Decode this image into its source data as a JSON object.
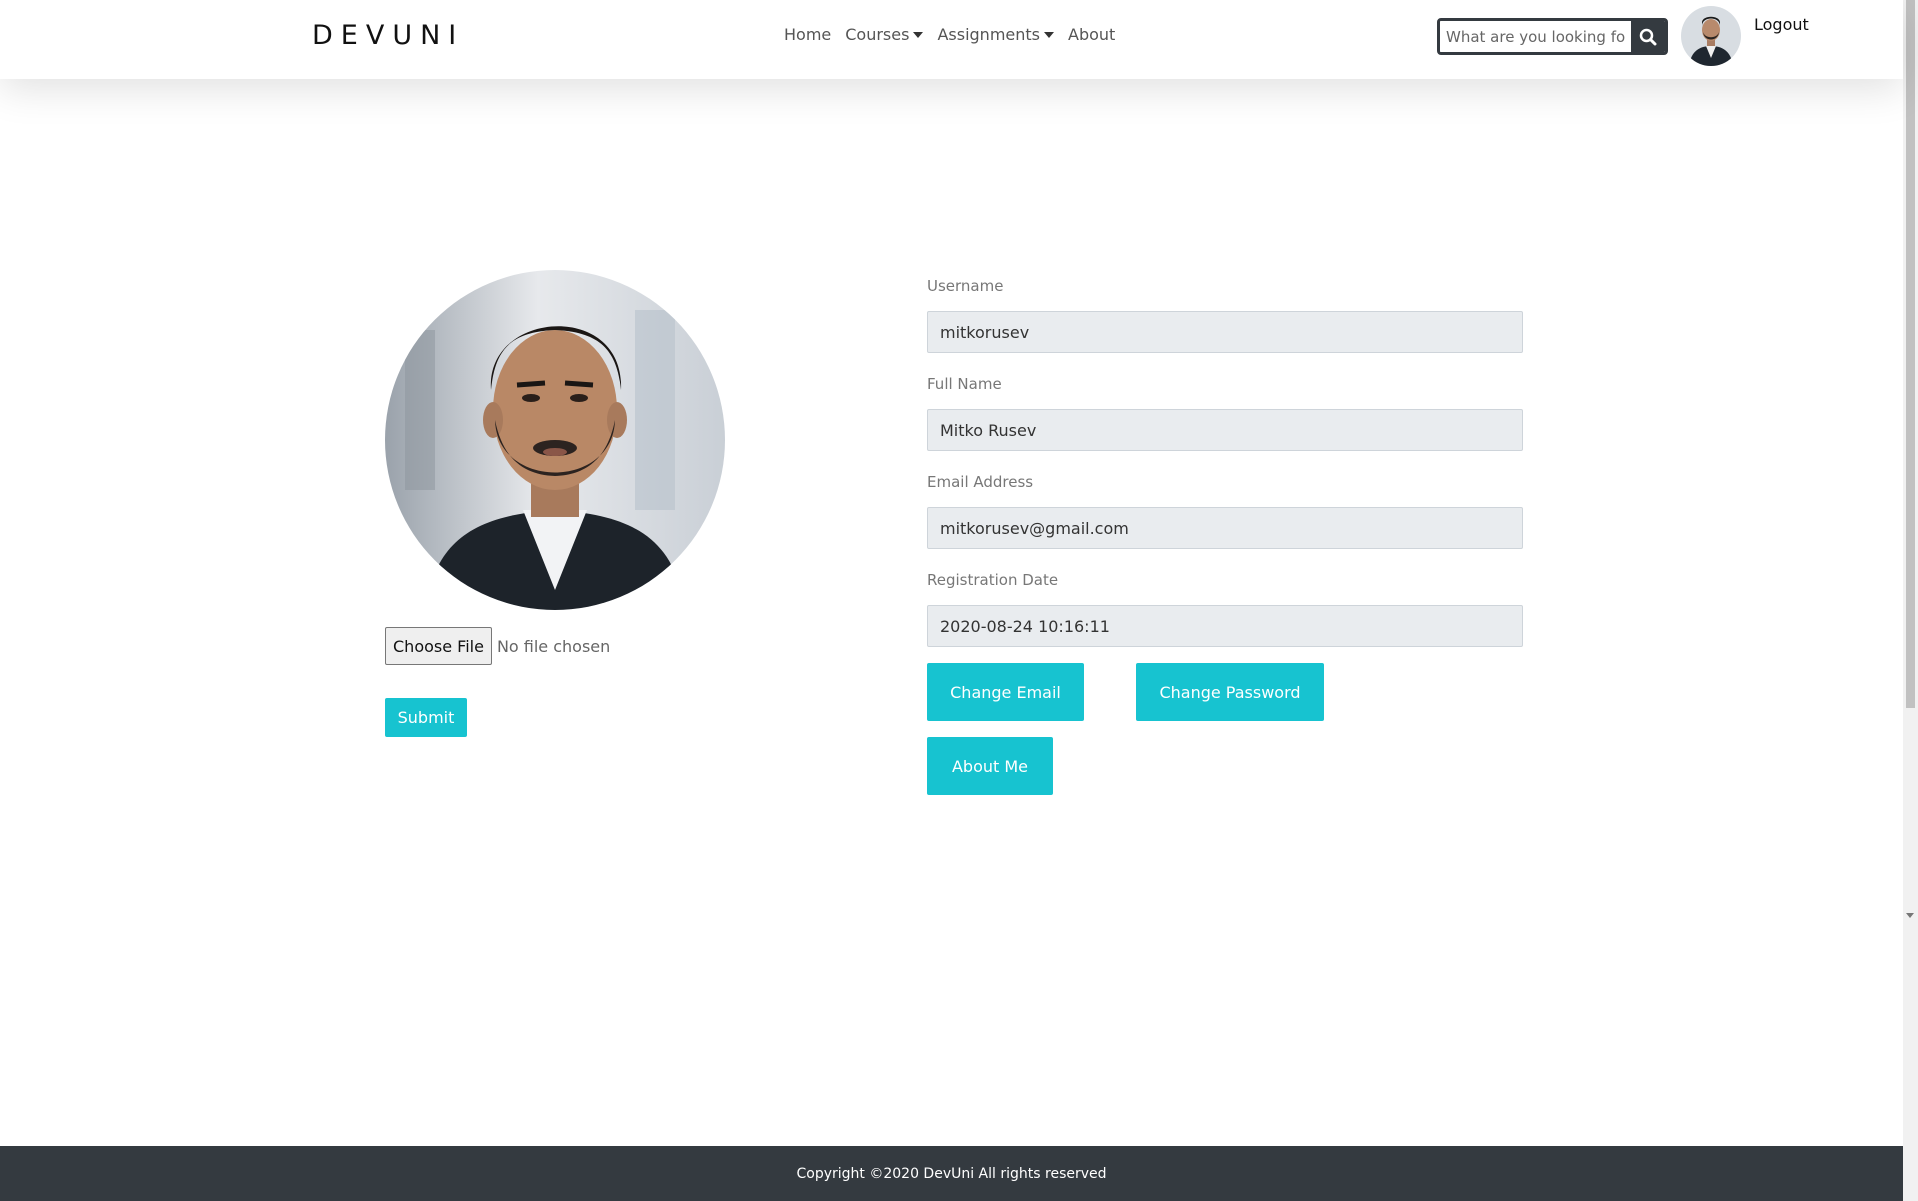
{
  "nav": {
    "brand": "DEVUNI",
    "links": [
      "Home",
      "Courses",
      "Assignments",
      "About"
    ],
    "search_placeholder": "What are you looking for",
    "logout": "Logout"
  },
  "profile": {
    "choose_file": "Choose File",
    "no_file": "No file chosen",
    "submit": "Submit",
    "fields": [
      {
        "label": "Username",
        "value": "mitkorusev"
      },
      {
        "label": "Full Name",
        "value": "Mitko Rusev"
      },
      {
        "label": "Email Address",
        "value": "mitkorusev@gmail.com"
      },
      {
        "label": "Registration Date",
        "value": "2020-08-24 10:16:11"
      }
    ],
    "buttons": {
      "change_email": "Change Email",
      "change_password": "Change Password",
      "about_me": "About Me"
    }
  },
  "footer": {
    "copyright": "Copyright ©2020 DevUni All rights reserved"
  },
  "colors": {
    "accent": "#17c3d0",
    "dark": "#343a40",
    "field_bg": "#e9ecef"
  }
}
